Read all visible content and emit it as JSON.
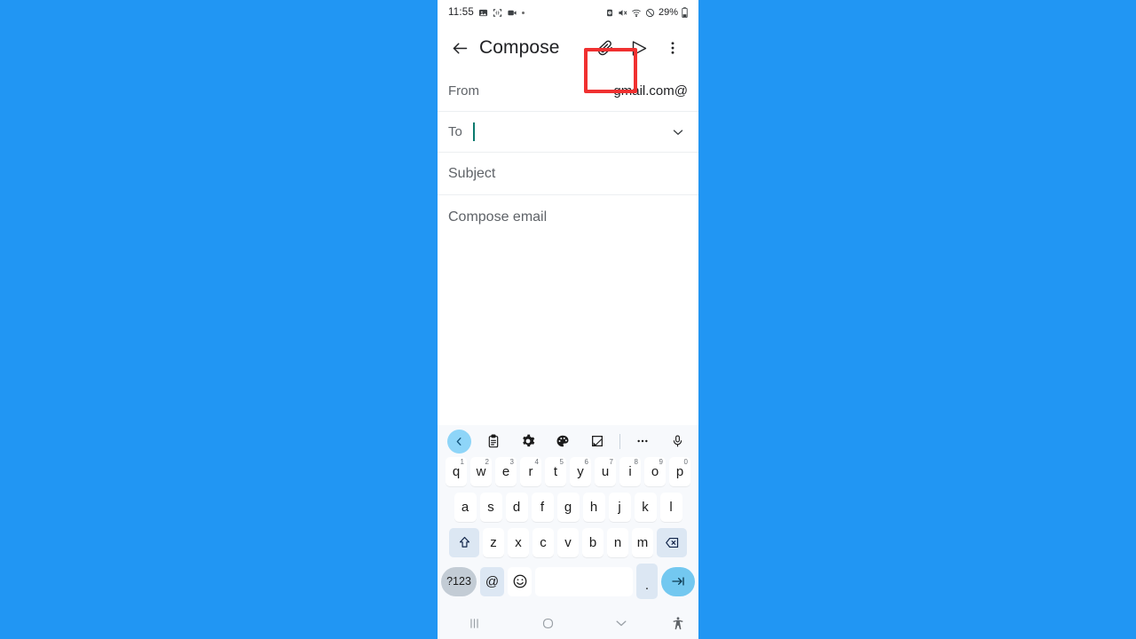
{
  "background_color": "#2196f3",
  "device": {
    "statusbar": {
      "time": "11:55",
      "left_icons": [
        "photo-icon",
        "screenshot-icon",
        "video-icon",
        "dot-indicator"
      ],
      "right_icons": [
        "alarm-icon",
        "mute-icon",
        "wifi-icon",
        "dnd-icon"
      ],
      "battery_percent": "29%",
      "battery_icon": "battery-icon"
    },
    "navbar": {
      "recents_icon": "recents-icon",
      "home_icon": "home-icon",
      "hide_keyboard_icon": "chevron-down-icon",
      "accessibility_icon": "accessibility-icon"
    }
  },
  "appbar": {
    "back_icon": "arrow-left-icon",
    "title": "Compose",
    "attach_icon": "paperclip-icon",
    "send_icon": "send-icon",
    "overflow_icon": "more-vertical-icon",
    "highlight_color": "#f03030",
    "highlighted_action": "attach-button"
  },
  "compose": {
    "from_label": "From",
    "from_value": "@gmail.com",
    "to_label": "To",
    "to_value": "",
    "to_expand_icon": "chevron-down-icon",
    "subject_placeholder": "Subject",
    "subject_value": "",
    "body_placeholder": "Compose email",
    "body_value": "",
    "caret_color": "#0b7a6e"
  },
  "keyboard": {
    "toolbar": [
      {
        "name": "keyboard-back-button",
        "icon": "chevron-left-icon",
        "highlight": "#8ed5f8"
      },
      {
        "name": "clipboard-button",
        "icon": "clipboard-icon"
      },
      {
        "name": "settings-button",
        "icon": "gear-icon"
      },
      {
        "name": "theme-button",
        "icon": "palette-icon"
      },
      {
        "name": "handwriting-button",
        "icon": "handwriting-icon"
      },
      {
        "name": "toolbar-divider",
        "icon": "divider"
      },
      {
        "name": "more-options-button",
        "icon": "more-horizontal-icon"
      },
      {
        "name": "voice-input-button",
        "icon": "microphone-icon"
      }
    ],
    "row1": [
      {
        "key": "q",
        "num": "1"
      },
      {
        "key": "w",
        "num": "2"
      },
      {
        "key": "e",
        "num": "3"
      },
      {
        "key": "r",
        "num": "4"
      },
      {
        "key": "t",
        "num": "5"
      },
      {
        "key": "y",
        "num": "6"
      },
      {
        "key": "u",
        "num": "7"
      },
      {
        "key": "i",
        "num": "8"
      },
      {
        "key": "o",
        "num": "9"
      },
      {
        "key": "p",
        "num": "0"
      }
    ],
    "row2": [
      "a",
      "s",
      "d",
      "f",
      "g",
      "h",
      "j",
      "k",
      "l"
    ],
    "row3_letters": [
      "z",
      "x",
      "c",
      "v",
      "b",
      "n",
      "m"
    ],
    "shift_icon": "shift-icon",
    "backspace_icon": "backspace-icon",
    "row4": {
      "symbols_label": "?123",
      "at_label": "@",
      "emoji_icon": "emoji-icon",
      "space_label": "",
      "period_label": ".",
      "enter_icon": "tab-arrow-icon"
    }
  }
}
